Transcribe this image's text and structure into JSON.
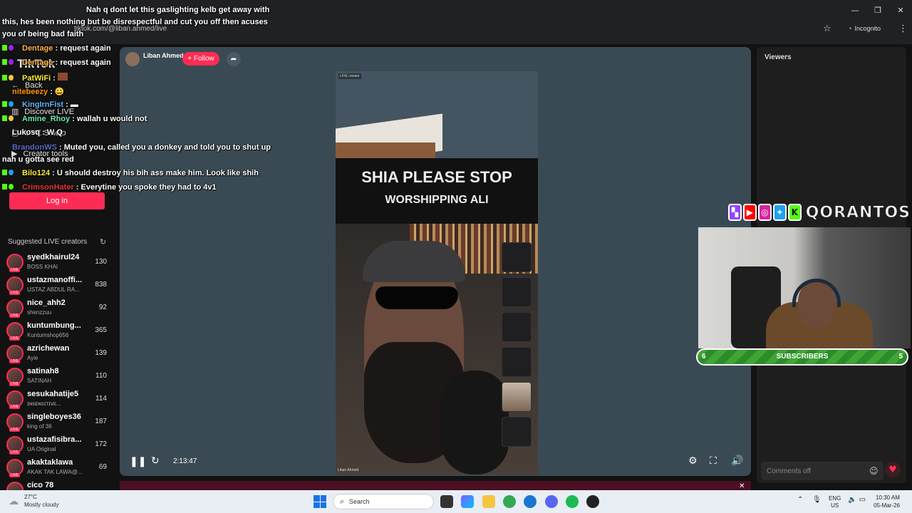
{
  "browser": {
    "url": "tiktok.com/@liban.ahmed/live",
    "incognito_label": "Incognito",
    "window_min": "—",
    "window_max": "❐",
    "window_close": "✕"
  },
  "sidebar": {
    "logo": "TikTok",
    "nav": [
      {
        "label": "Back",
        "icon": "←"
      },
      {
        "label": "Discover LIVE",
        "icon": "▥"
      },
      {
        "label": "LIVE Studio",
        "icon": "▢"
      },
      {
        "label": "Creator tools",
        "icon": "▶"
      }
    ],
    "login_label": "Log in",
    "suggested_title": "Suggested LIVE creators",
    "creators": [
      {
        "name": "syedkhairul24",
        "sub": "BOSS KHAI",
        "count": "130"
      },
      {
        "name": "ustazmanoffi...",
        "sub": "USTAZ ABDUL RA...",
        "count": "838"
      },
      {
        "name": "nice_ahh2",
        "sub": "shenzzuu",
        "count": "92"
      },
      {
        "name": "kuntumbung...",
        "sub": "Kuntumshop656",
        "count": "365"
      },
      {
        "name": "azrichewan",
        "sub": "Ayie",
        "count": "139"
      },
      {
        "name": "satinah8",
        "sub": "SATINAH",
        "count": "110"
      },
      {
        "name": "sesukahatije5",
        "sub": "ɪɴsᴇɴsɪᴛɪᴠᴇ...",
        "count": "114"
      },
      {
        "name": "singleboyes36",
        "sub": "king of 36",
        "count": "187"
      },
      {
        "name": "ustazafisibra...",
        "sub": "UA Original",
        "count": "172"
      },
      {
        "name": "akaktaklawa",
        "sub": "AKAK TAK LAWA@...",
        "count": "69"
      },
      {
        "name": "cico 78",
        "sub": "",
        "count": ""
      }
    ]
  },
  "live": {
    "host_name": "Liban Ahmed",
    "follow_label": "+ Follow",
    "live_creator_tag": "LIVE creator",
    "caption_line1": "SHIA PLEASE STOP",
    "caption_line2": "WORSHIPPING ALI",
    "video_host_label": "Liban Ahmed",
    "time": "2:13:47"
  },
  "viewers_panel": {
    "title": "Viewers",
    "comments_placeholder": "Comments off"
  },
  "overlay": {
    "brand": "QORANTOS",
    "subscribers_label": "SUBSCRIBERS",
    "subscribers_left": "6",
    "subscribers_right": "5",
    "brand_colors": {
      "twitch": "#9146ff",
      "youtube": "#ff0000",
      "instagram": "#d6249f",
      "twitter": "#1da1f2",
      "kick": "#53fc18"
    }
  },
  "chat": [
    {
      "user": "",
      "text": "Nah q dont let this gaslighting kelb get away with this, hes been nothing but be disrespectful and cut you off then acuses you of being bad faith",
      "color": "#ffffff"
    },
    {
      "user": "Dentage",
      "text": "request again",
      "color": "#ffb347"
    },
    {
      "user": "Dentage",
      "text": "request again",
      "color": "#ffb347"
    },
    {
      "user": "PatWiFi",
      "text": "",
      "color": "#ffeb3b"
    },
    {
      "user": "nitebeezy",
      "text": "",
      "color": "#ff9800"
    },
    {
      "user": "KingIrnFist",
      "text": "",
      "color": "#64b5f6"
    },
    {
      "user": "Amine_Rhoy",
      "text": "wallah u would not",
      "color": "#69f0ae"
    },
    {
      "user": "Lukosq",
      "text": "W Q",
      "color": "#ffffff"
    },
    {
      "user": "BrandonWS",
      "text": "Muted you, called you a donkey and told you to shut up nah u gotta see red",
      "color": "#5c6bc0"
    },
    {
      "user": "Bilo124",
      "text": "U should destroy his bih ass make him. Look like shih",
      "color": "#ffeb3b"
    },
    {
      "user": "CrimsonHater",
      "text": "Everytine you spoke they had to 4v1",
      "color": "#e53935"
    }
  ],
  "taskbar": {
    "weather_temp": "27°C",
    "weather_cond": "Mostly cloudy",
    "search_label": "Search",
    "lang_top": "ENG",
    "lang_bottom": "US",
    "time": "10:30 AM",
    "date": "05-Mar-26"
  }
}
